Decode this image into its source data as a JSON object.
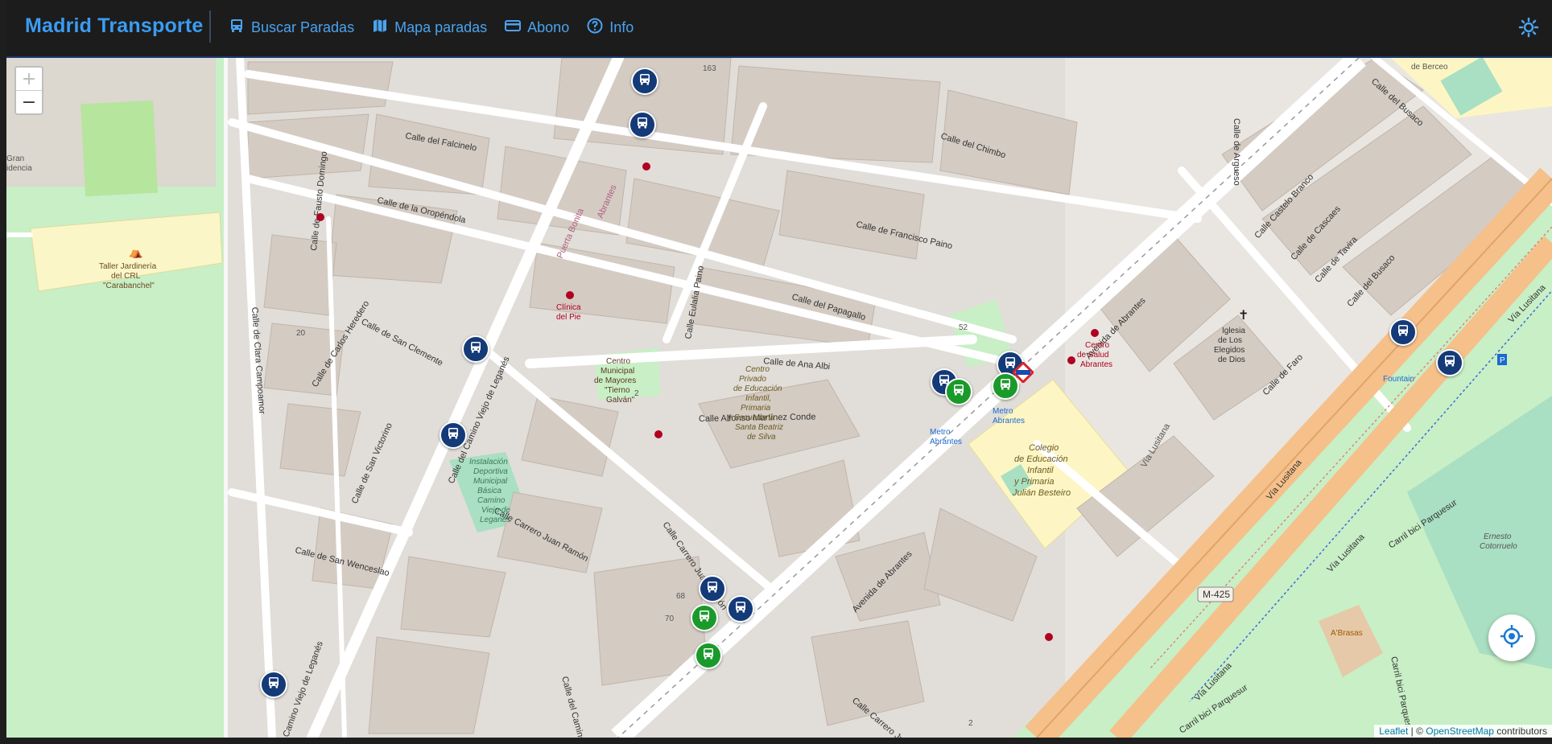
{
  "app": {
    "title": "Madrid Transporte",
    "accent": "#3a9cf2",
    "nav": [
      {
        "label": "Buscar Paradas",
        "icon": "bus-icon"
      },
      {
        "label": "Mapa paradas",
        "icon": "map-icon"
      },
      {
        "label": "Abono",
        "icon": "card-icon"
      },
      {
        "label": "Info",
        "icon": "question-icon"
      }
    ],
    "theme_icon": "sun-icon"
  },
  "map": {
    "zoom_in": "+",
    "zoom_out": "−",
    "streets": [
      "Calle del Falcinelo",
      "Calle del Chimbo",
      "Calle de la Oropéndola",
      "Calle de Francisco Paino",
      "Calle del Papagallo",
      "Calle de Ana Albi",
      "Calle Alfonso Martínez Conde",
      "Calle de San Clemente",
      "Calle de Carlos Heredero",
      "Calle de Fausto Domingo",
      "Calle de Clara Campoamor",
      "Calle de San Victorino",
      "Calle de San Wenceslao",
      "Calle Carrero Juan Ramón",
      "Calle del Camino Viejo de Leganés",
      "Avenida de Abrantes",
      "Vía Lusitana",
      "Calle de Faro",
      "Calle del Busaco",
      "Calle Castelo Branco",
      "Calle de Cascaes",
      "Calle de Tavira",
      "Calle de Argueso",
      "Calle Eulalia Paino",
      "Puerta Bonita",
      "Carril bici Parquesur",
      "Calle del Camino Viejo"
    ],
    "pois": [
      "Taller Jardinería del CRL \"Carabanchel\"",
      "Clínica del Pie",
      "Centro Municipal de Mayores \"Tierno Galván\"",
      "Centro Privado de Educación Infantil, Primaria y Secundaria Santa Beatriz de Silva",
      "Instalación Deportiva Municipal Básica Camino Viejo de Leganés",
      "Centro de Salud Abrantes",
      "Colegio de Educación Infantil y Primaria Julián Besteiro",
      "Iglesia de Los Elegidos de Dios",
      "Metro Abrantes",
      "Metro Abrantes",
      "Fountain",
      "Ernesto Cotorruelo",
      "A'Brasas",
      "M-425",
      "Gran Residencia",
      "de Berceo"
    ],
    "attribution": {
      "prefix": "Leaflet",
      "sep": " | © ",
      "link": "OpenStreetMap",
      "suffix": " contributors"
    }
  }
}
